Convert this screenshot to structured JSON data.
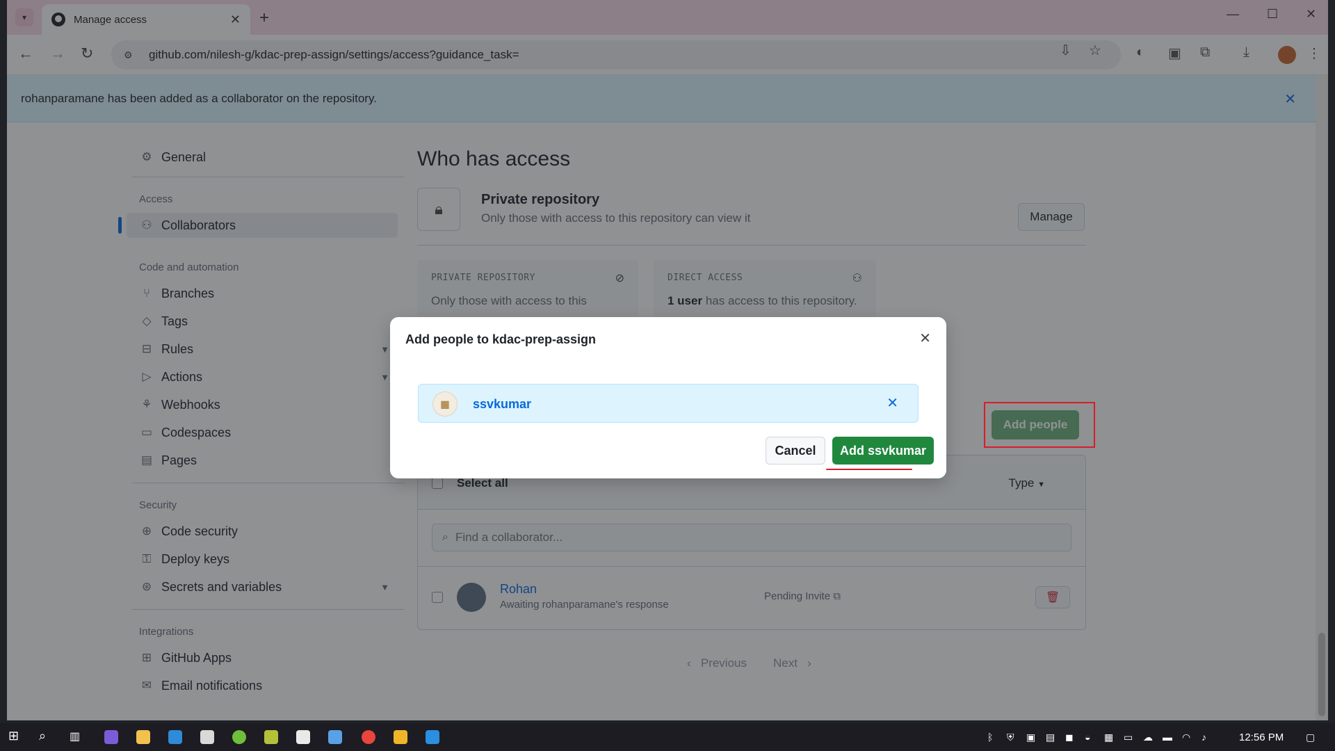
{
  "browser": {
    "tab_title": "Manage access",
    "url": "github.com/nilesh-g/kdac-prep-assign/settings/access?guidance_task="
  },
  "flash": {
    "message": "rohanparamane has been added as a collaborator on the repository."
  },
  "sidebar": {
    "general": "General",
    "access_heading": "Access",
    "collaborators": "Collaborators",
    "code_heading": "Code and automation",
    "branches": "Branches",
    "tags": "Tags",
    "rules": "Rules",
    "actions": "Actions",
    "webhooks": "Webhooks",
    "codespaces": "Codespaces",
    "pages": "Pages",
    "security_heading": "Security",
    "code_security": "Code security",
    "deploy_keys": "Deploy keys",
    "secrets": "Secrets and variables",
    "integrations_heading": "Integrations",
    "github_apps": "GitHub Apps",
    "email_notifications": "Email notifications"
  },
  "main": {
    "title": "Who has access",
    "private_title": "Private repository",
    "private_desc": "Only those with access to this repository can view it",
    "manage_label": "Manage",
    "card1_label": "PRIVATE REPOSITORY",
    "card1_text": "Only those with access to this",
    "card2_label": "DIRECT ACCESS",
    "card2_count": "1 user",
    "card2_text": " has access to this repository.",
    "add_people_label": "Add people",
    "select_all": "Select all",
    "type_label": "Type",
    "search_placeholder": "Find a collaborator...",
    "row_name": "Rohan",
    "row_sub": "Awaiting rohanparamane's response",
    "row_status": "Pending Invite",
    "prev_label": "Previous",
    "next_label": "Next"
  },
  "dialog": {
    "title": "Add people to kdac-prep-assign",
    "selected_user": "ssvkumar",
    "cancel_label": "Cancel",
    "confirm_label": "Add ssvkumar"
  },
  "taskbar": {
    "time": "12:56 PM"
  },
  "colors": {
    "primary_green": "#1f883d",
    "link_blue": "#0969da",
    "highlight_red": "#d71e2a"
  }
}
